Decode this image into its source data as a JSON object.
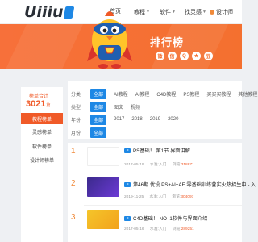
{
  "logo": {
    "text": "Uiiiu"
  },
  "nav": {
    "home": "首页",
    "tutorial": "教程",
    "software": "软件",
    "find_inspiration": "找灵感",
    "designer": "设计师"
  },
  "banner": {
    "title": "排行榜",
    "share_icons": [
      "weibo-icon",
      "wechat-icon",
      "qq-icon",
      "qzone-icon",
      "douban-icon"
    ]
  },
  "sidebar": {
    "stat_label": "榜单合计",
    "stat_value": "3021",
    "stat_unit": "篇",
    "items": [
      "教程榜单",
      "灵感榜单",
      "软件榜单",
      "设计师榜单"
    ]
  },
  "filters": {
    "category": {
      "label": "分类",
      "options": [
        "全部",
        "AI教程",
        "AI教程",
        "C4D教程",
        "PS教程",
        "买买买教程",
        "其他教程"
      ]
    },
    "type": {
      "label": "类型",
      "options": [
        "全部",
        "图文",
        "视频"
      ]
    },
    "year": {
      "label": "年份",
      "options": [
        "全部",
        "2017",
        "2018",
        "2019",
        "2020"
      ]
    },
    "month": {
      "label": "月份",
      "options": [
        "全部"
      ]
    }
  },
  "rank_items": [
    {
      "rank": "1",
      "title": "PS基础！ 第1节 界面讲解",
      "date": "2017-05-19",
      "level": "水准:入门",
      "views_label": "浏览:",
      "views": "318871"
    },
    {
      "rank": "2",
      "title": "第46期 优设 PS+AI+AE 零基础训练营实火热招生中 - 入",
      "date": "2019-11-25",
      "level": "水准:入门",
      "views_label": "浏览:",
      "views": "304097"
    },
    {
      "rank": "3",
      "title": "C4D基础！ NO .1软件与界面介绍",
      "date": "2017-05-16",
      "level": "水准:入门",
      "views_label": "浏览:",
      "views": "289251"
    }
  ],
  "colors": {
    "accent": "#f05a28",
    "blue": "#1e88e5",
    "banner": "#f4702f"
  }
}
